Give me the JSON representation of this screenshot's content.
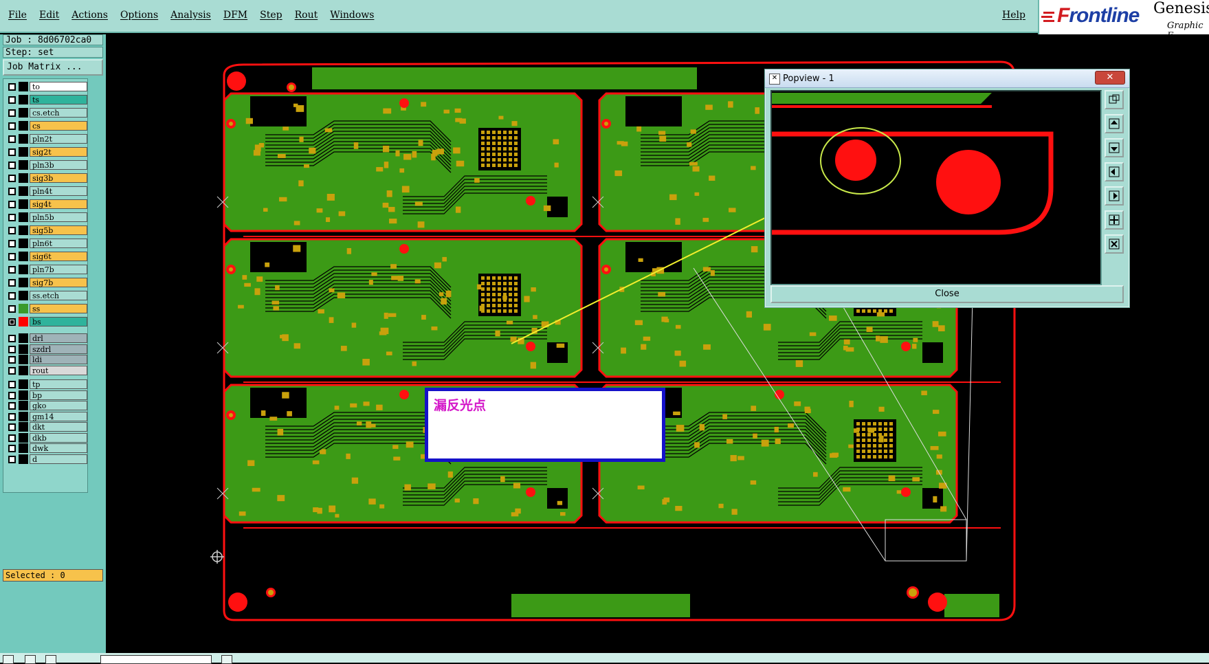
{
  "menu": {
    "items": [
      "File",
      "Edit",
      "Actions",
      "Options",
      "Analysis",
      "DFM",
      "Step",
      "Rout",
      "Windows"
    ],
    "help": "Help"
  },
  "logo": {
    "brand_f": "F",
    "brand_rest": "rontline",
    "product": "Genesis",
    "subtitle": "Graphic E"
  },
  "job": {
    "label": "Job : 8d06702ca0",
    "step": "Step: set",
    "matrix_button": "Job Matrix ..."
  },
  "layers": [
    {
      "name": "to",
      "color": "#ffffff",
      "swatch": "#000000",
      "checked": false
    },
    {
      "name": "ts",
      "color": "#2fb39c",
      "swatch": "#000000",
      "checked": false
    },
    {
      "name": "cs.etch",
      "color": "#a9dcd3",
      "swatch": "#000000",
      "checked": false
    },
    {
      "name": "cs",
      "color": "#f7c24b",
      "swatch": "#000000",
      "checked": false
    },
    {
      "name": "pln2t",
      "color": "#a9dcd3",
      "swatch": "#000000",
      "checked": false
    },
    {
      "name": "sig2t",
      "color": "#f7c24b",
      "swatch": "#000000",
      "checked": false
    },
    {
      "name": "pln3b",
      "color": "#a9dcd3",
      "swatch": "#000000",
      "checked": false
    },
    {
      "name": "sig3b",
      "color": "#f7c24b",
      "swatch": "#000000",
      "checked": false
    },
    {
      "name": "pln4t",
      "color": "#a9dcd3",
      "swatch": "#000000",
      "checked": false
    },
    {
      "name": "sig4t",
      "color": "#f7c24b",
      "swatch": "#000000",
      "checked": false
    },
    {
      "name": "pln5b",
      "color": "#a9dcd3",
      "swatch": "#000000",
      "checked": false
    },
    {
      "name": "sig5b",
      "color": "#f7c24b",
      "swatch": "#000000",
      "checked": false
    },
    {
      "name": "pln6t",
      "color": "#a9dcd3",
      "swatch": "#000000",
      "checked": false
    },
    {
      "name": "sig6t",
      "color": "#f7c24b",
      "swatch": "#000000",
      "checked": false
    },
    {
      "name": "pln7b",
      "color": "#a9dcd3",
      "swatch": "#000000",
      "checked": false
    },
    {
      "name": "sig7b",
      "color": "#f7c24b",
      "swatch": "#000000",
      "checked": false
    },
    {
      "name": "ss.etch",
      "color": "#a9dcd3",
      "swatch": "#000000",
      "checked": false
    },
    {
      "name": "ss",
      "color": "#f7c24b",
      "swatch": "#3a9a2a",
      "checked": false
    },
    {
      "name": "bs",
      "color": "#2fb39c",
      "swatch": "#ff0000",
      "checked": true
    },
    {
      "name": "drl",
      "color": "#9fb3b8",
      "swatch": "#000000",
      "checked": false
    },
    {
      "name": "szdrl",
      "color": "#9fb3b8",
      "swatch": "#000000",
      "checked": false
    },
    {
      "name": "ldi",
      "color": "#9fb3b8",
      "swatch": "#000000",
      "checked": false
    },
    {
      "name": "rout",
      "color": "#d9d9d9",
      "swatch": "#000000",
      "checked": false
    },
    {
      "name": "tp",
      "color": "#a9dcd3",
      "swatch": "#000000",
      "checked": false
    },
    {
      "name": "bp",
      "color": "#a9dcd3",
      "swatch": "#000000",
      "checked": false
    },
    {
      "name": "gko",
      "color": "#a9dcd3",
      "swatch": "#000000",
      "checked": false
    },
    {
      "name": "gm14",
      "color": "#a9dcd3",
      "swatch": "#000000",
      "checked": false
    },
    {
      "name": "dkt",
      "color": "#a9dcd3",
      "swatch": "#000000",
      "checked": false
    },
    {
      "name": "dkb",
      "color": "#a9dcd3",
      "swatch": "#000000",
      "checked": false
    },
    {
      "name": "dwk",
      "color": "#a9dcd3",
      "swatch": "#000000",
      "checked": false
    },
    {
      "name": "d",
      "color": "#a9dcd3",
      "swatch": "#000000",
      "checked": false
    }
  ],
  "selected": "Selected : 0",
  "popview": {
    "title": "Popview - 1",
    "close": "Close",
    "close_x": "✕"
  },
  "note": {
    "text": "漏反光点"
  },
  "colors": {
    "board_green": "#3c9a16",
    "outline_red": "#ff1010",
    "pad_gold": "#c9a10c",
    "annotation_yellow": "#f3ef2d"
  }
}
